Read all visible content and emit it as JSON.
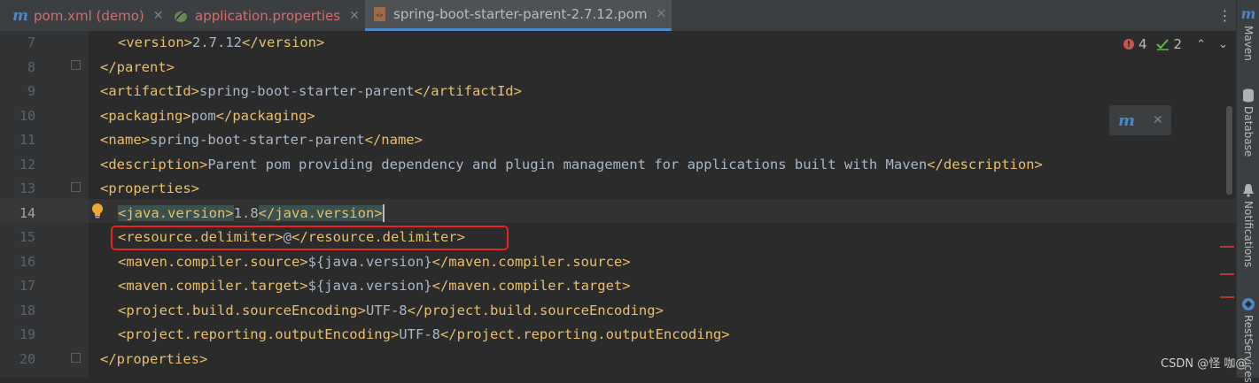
{
  "tabs": [
    {
      "label": "pom.xml (demo)",
      "color": "#d46d6d",
      "icon": "maven-icon"
    },
    {
      "label": "application.properties",
      "color": "#d46d6d",
      "icon": "spring-leaf-icon"
    },
    {
      "label": "spring-boot-starter-parent-2.7.12.pom",
      "color": "#bbbbbb",
      "icon": "xml-file-icon"
    }
  ],
  "tab_close": "✕",
  "tab_more": "⋮",
  "m_glyph": "m",
  "editor": {
    "lines": [
      {
        "n": "7"
      },
      {
        "n": "8"
      },
      {
        "n": "9"
      },
      {
        "n": "10"
      },
      {
        "n": "11"
      },
      {
        "n": "12"
      },
      {
        "n": "13"
      },
      {
        "n": "14"
      },
      {
        "n": "15"
      },
      {
        "n": "16"
      },
      {
        "n": "17"
      },
      {
        "n": "18"
      },
      {
        "n": "19"
      },
      {
        "n": "20"
      }
    ],
    "code": {
      "l7": {
        "open": "<version>",
        "text": "2.7.12",
        "close": "</version>"
      },
      "l8": {
        "open": "</parent>"
      },
      "l9": {
        "open": "<artifactId>",
        "text": "spring-boot-starter-parent",
        "close": "</artifactId>"
      },
      "l10": {
        "open": "<packaging>",
        "text": "pom",
        "close": "</packaging>"
      },
      "l11": {
        "open": "<name>",
        "text": "spring-boot-starter-parent",
        "close": "</name>"
      },
      "l12": {
        "open": "<description>",
        "text": "Parent pom providing dependency and plugin management for applications built with Maven",
        "close": "</description>"
      },
      "l13": {
        "open": "<properties>"
      },
      "l14": {
        "open": "<java.version>",
        "text": "1.8",
        "close": "</java.version>"
      },
      "l15": {
        "open": "<resource.delimiter>",
        "text": "@",
        "close": "</resource.delimiter>"
      },
      "l16": {
        "open": "<maven.compiler.source>",
        "text": "${java.version}",
        "close": "</maven.compiler.source>"
      },
      "l17": {
        "open": "<maven.compiler.target>",
        "text": "${java.version}",
        "close": "</maven.compiler.target>"
      },
      "l18": {
        "open": "<project.build.sourceEncoding>",
        "text": "UTF-8",
        "close": "</project.build.sourceEncoding>"
      },
      "l19": {
        "open": "<project.reporting.outputEncoding>",
        "text": "UTF-8",
        "close": "</project.reporting.outputEncoding>"
      },
      "l20": {
        "open": "</properties>"
      }
    }
  },
  "indicators": {
    "errors": "4",
    "err_glyph": "!",
    "checks": "2",
    "up": "⌃",
    "down": "⌄"
  },
  "popup": {
    "close": "✕"
  },
  "sidebar": {
    "maven": "Maven",
    "database": "Database",
    "notifications": "Notifications",
    "rest": "RestServices"
  },
  "watermark": "CSDN @怪 咖@",
  "colors": {
    "tag": "#e8bf6a",
    "text": "#a9b7c6",
    "accent": "#4a88c7",
    "error": "#c75450",
    "highlight_box": "#e8231f"
  }
}
